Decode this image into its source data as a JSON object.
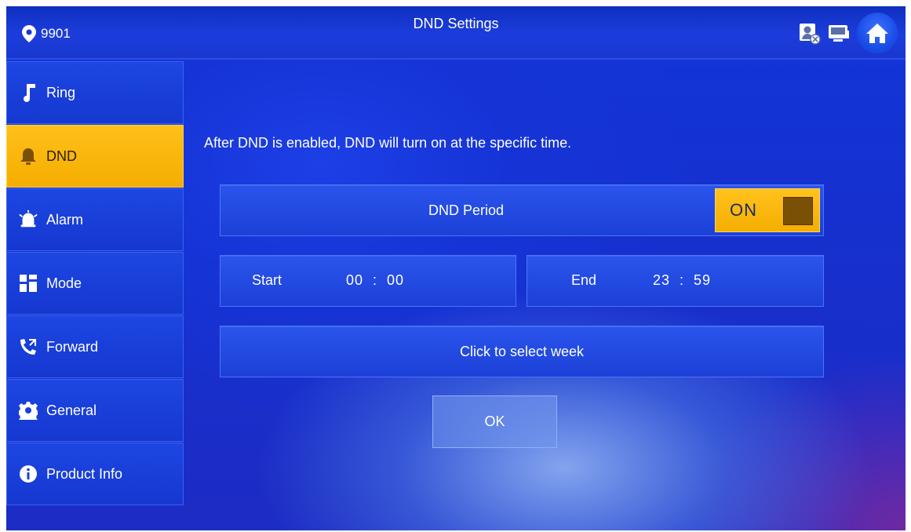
{
  "header": {
    "location_icon": "map-pin-icon",
    "room": "9901",
    "title": "DND Settings",
    "status_icons": [
      "contact-offline-icon",
      "monitor-icon"
    ],
    "home_icon": "home-icon"
  },
  "sidebar": {
    "items": [
      {
        "label": "Ring",
        "icon": "music-note-icon",
        "active": false
      },
      {
        "label": "DND",
        "icon": "bell-icon",
        "active": true
      },
      {
        "label": "Alarm",
        "icon": "siren-icon",
        "active": false
      },
      {
        "label": "Mode",
        "icon": "grid-icon",
        "active": false
      },
      {
        "label": "Forward",
        "icon": "call-forward-icon",
        "active": false
      },
      {
        "label": "General",
        "icon": "gear-icon",
        "active": false
      },
      {
        "label": "Product Info",
        "icon": "info-icon",
        "active": false
      }
    ]
  },
  "main": {
    "description": "After DND is enabled, DND will turn on at the specific time.",
    "period": {
      "label": "DND Period",
      "toggle_label": "ON",
      "enabled": true
    },
    "start": {
      "label": "Start",
      "value": "00  :  00"
    },
    "end": {
      "label": "End",
      "value": "23  :  59"
    },
    "week_label": "Click to select week",
    "ok_label": "OK"
  },
  "colors": {
    "accent": "#f5ae00",
    "background": "#1634d6",
    "panel": "#1c40d8"
  }
}
